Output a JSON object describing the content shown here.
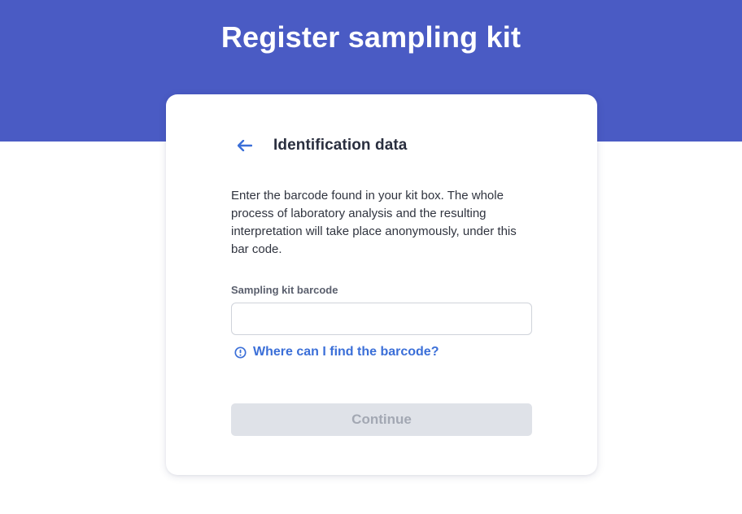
{
  "header": {
    "title": "Register sampling kit",
    "background_color": "#4a5bc4"
  },
  "card": {
    "back_icon": "arrow-left-icon",
    "title": "Identification data",
    "description": "Enter the barcode found in your kit box. The whole process of laboratory analysis and the resulting interpretation will take place anonymously, under this bar code.",
    "barcode_field": {
      "label": "Sampling kit barcode",
      "value": "",
      "placeholder": ""
    },
    "help_link": {
      "icon": "info-circle-icon",
      "label": "Where can I find the barcode?",
      "color": "#3b6fd8"
    },
    "continue_button": {
      "label": "Continue",
      "disabled": true
    }
  }
}
